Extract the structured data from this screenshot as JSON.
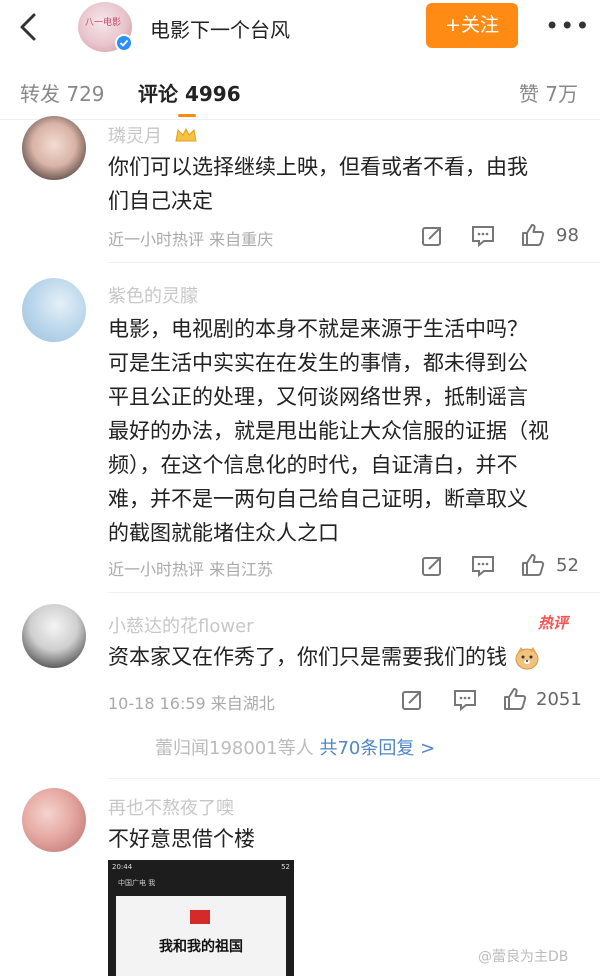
{
  "header": {
    "title": "电影下一个台风",
    "follow_label": "+关注",
    "more_label": "•••",
    "avatar_logo_text": "八一电影"
  },
  "tabs": {
    "repost": "转发 729",
    "comment": "评论 4996",
    "like": "赞 7万"
  },
  "comments": [
    {
      "name": "璘灵月",
      "text_lines": [
        "你们可以选择继续上映，但看或者不看，由我",
        "们自己决定"
      ],
      "meta": "近一小时热评  来自重庆",
      "likes": "98"
    },
    {
      "name": "紫色的灵朦",
      "text_lines": [
        "电影，电视剧的本身不就是来源于生活中吗？",
        "可是生活中实实在在发生的事情，都未得到公",
        "平且公正的处理，又何谈网络世界，抵制谣言",
        "最好的办法，就是甩出能让大众信服的证据（视",
        "频），在这个信息化的时代，自证清白，并不",
        "难，并不是一两句自己给自己证明，断章取义",
        "的截图就能堵住众人之口"
      ],
      "meta": "近一小时热评  来自江苏",
      "likes": "52"
    },
    {
      "name": "小慈达的花flower",
      "hot_tag": "热评",
      "text_lines": [
        "资本家又在作秀了，你们只是需要我们的钱"
      ],
      "meta": "10-18 16:59  来自湖北",
      "likes": "2051",
      "replies_prefix": "蕾归闻198001等人",
      "replies_link": "共70条回复 >"
    },
    {
      "name": "再也不熬夜了噢",
      "text_lines": [
        "不好意思借个楼"
      ],
      "embed": {
        "status_left": "20:44",
        "status_right": "52",
        "nav_text": "中国广电  我",
        "card_title": "我和我的祖国"
      }
    }
  ],
  "watermark": "@蕾良为主DB"
}
